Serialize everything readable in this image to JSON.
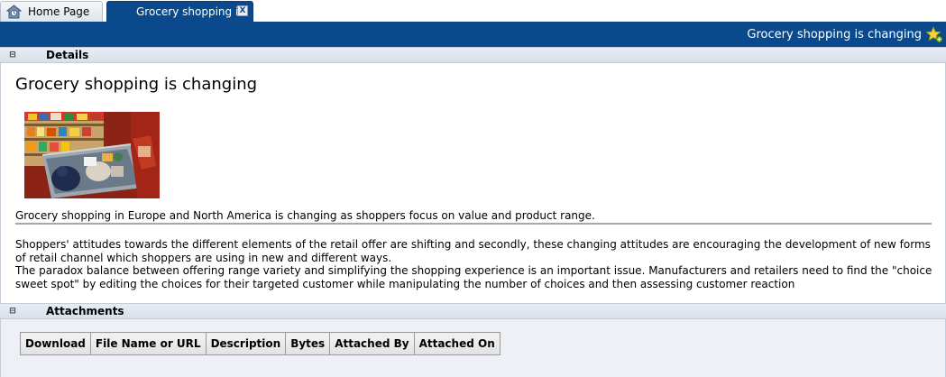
{
  "tabs": [
    {
      "label": "Home Page",
      "icon": "home-page-icon",
      "active": false
    },
    {
      "label": "Grocery shopping i..",
      "icon": "close-icon",
      "close_label": "X",
      "active": true
    }
  ],
  "titlebar": {
    "title": "Grocery shopping is changing",
    "icon": "favorite-star-icon"
  },
  "details": {
    "section_label": "Details",
    "collapse_symbol": "⊟",
    "title": "Grocery shopping is changing",
    "image": "grocery-cart-photo",
    "summary": "Grocery shopping in Europe and North America is changing as shoppers focus on value and product range.",
    "paragraphs": [
      "Shoppers' attitudes towards the different elements of the retail offer are shifting and secondly, these changing attitudes are encouraging the development of new forms of retail channel which shoppers are using in new and different ways.",
      "The paradox balance between offering range variety and simplifying the shopping experience is an important issue. Manufacturers and retailers need to find the \"choice sweet spot\" by editing the choices for their targeted customer while manipulating the number of choices and then assessing customer reaction"
    ]
  },
  "attachments": {
    "section_label": "Attachments",
    "collapse_symbol": "⊟",
    "columns": [
      "Download",
      "File Name or URL",
      "Description",
      "Bytes",
      "Attached By",
      "Attached On"
    ]
  },
  "colors": {
    "header_blue": "#0a4a8c",
    "section_header": "#dde4ec",
    "attachments_bg": "#edf1f5"
  }
}
